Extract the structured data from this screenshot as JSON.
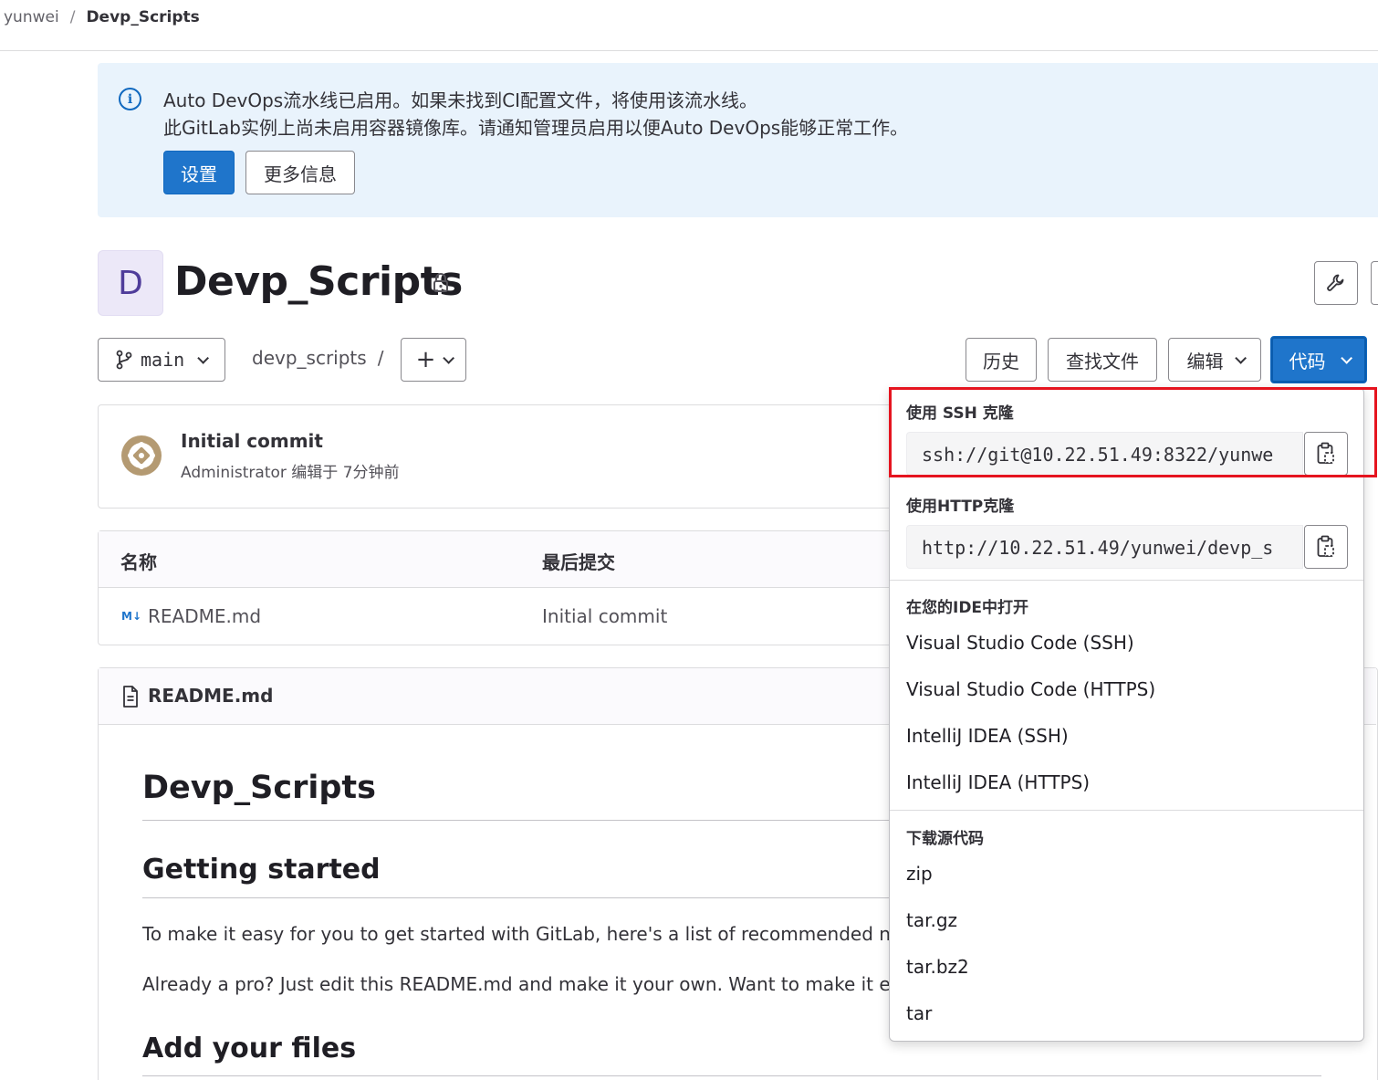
{
  "breadcrumb": {
    "parent": "yunwei",
    "separator": "/",
    "current": "Devp_Scripts"
  },
  "alert": {
    "line1": "Auto DevOps流水线已启用。如果未找到CI配置文件，将使用该流水线。",
    "line2": "此GitLab实例上尚未启用容器镜像库。请通知管理员启用以便Auto DevOps能够正常工作。",
    "primary_button": "设置",
    "secondary_button": "更多信息",
    "icon": "info-icon"
  },
  "project": {
    "avatar_letter": "D",
    "title": "Devp_Scripts",
    "visibility_icon": "lock-icon"
  },
  "toolbar": {
    "branch": "main",
    "path": "devp_scripts",
    "path_separator": "/",
    "history": "历史",
    "find_file": "查找文件",
    "edit": "编辑",
    "code": "代码"
  },
  "commit": {
    "title": "Initial commit",
    "author": "Administrator",
    "meta": "编辑于 7分钟前"
  },
  "files": {
    "columns": [
      "名称",
      "最后提交"
    ],
    "rows": [
      {
        "name": "README.md",
        "last_commit": "Initial commit",
        "icon": "markdown-icon"
      }
    ]
  },
  "readme": {
    "filename": "README.md",
    "h1": "Devp_Scripts",
    "h2_getting_started": "Getting started",
    "para1": "To make it easy for you to get started with GitLab, here's a list of recommended ne",
    "para2": "Already a pro? Just edit this README.md and make it your own. Want to make it ea",
    "h2_add_files": "Add your files"
  },
  "code_dropdown": {
    "ssh_heading": "使用 SSH 克隆",
    "ssh_url": "ssh://git@10.22.51.49:8322/yunwe",
    "http_heading": "使用HTTP克隆",
    "http_url": "http://10.22.51.49/yunwei/devp_s",
    "ide_heading": "在您的IDE中打开",
    "ide_items": [
      "Visual Studio Code (SSH)",
      "Visual Studio Code (HTTPS)",
      "IntelliJ IDEA (SSH)",
      "IntelliJ IDEA (HTTPS)"
    ],
    "download_heading": "下载源代码",
    "download_items": [
      "zip",
      "tar.gz",
      "tar.bz2",
      "tar"
    ]
  },
  "colors": {
    "primary": "#1f75cb",
    "highlight_box": "#e5141f",
    "alert_bg": "#e9f3fc"
  }
}
